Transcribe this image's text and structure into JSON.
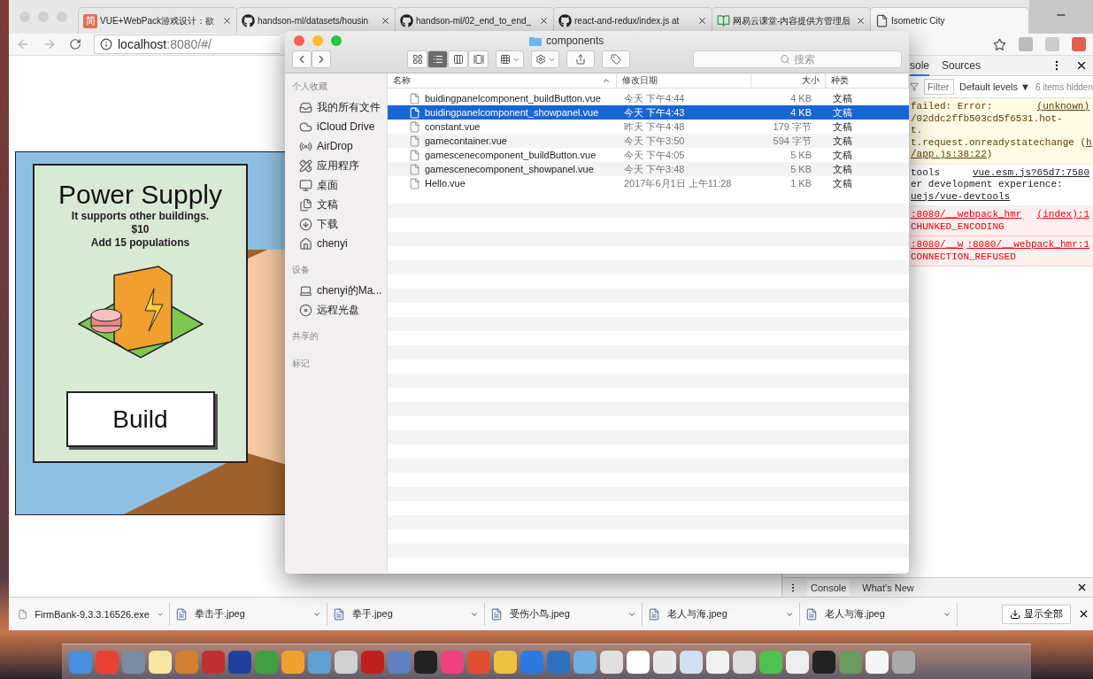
{
  "browser": {
    "tabs": [
      {
        "title": "VUE+WebPack游戏设计：欲",
        "kind": "badge",
        "badge": "简",
        "selected": false
      },
      {
        "title": "handson-ml/datasets/housin",
        "kind": "github",
        "selected": false
      },
      {
        "title": "handson-ml/02_end_to_end_",
        "kind": "github",
        "selected": false
      },
      {
        "title": "react-and-redux/index.js at",
        "kind": "github",
        "selected": false
      },
      {
        "title": "网易云课堂-内容提供方管理后",
        "kind": "book",
        "selected": false
      },
      {
        "title": "Isometric City",
        "kind": "page",
        "selected": true
      }
    ],
    "address": {
      "host": "localhost",
      "rest": ":8080/#/"
    }
  },
  "game": {
    "card": {
      "title": "Power Supply",
      "lines": [
        "It supports other buildings.",
        "$10",
        "Add 15 populations"
      ],
      "button": "Build"
    }
  },
  "finder": {
    "title": "components",
    "search_placeholder": "搜索",
    "sidebar": [
      {
        "heading": "个人收藏",
        "items": [
          {
            "label": "我的所有文件",
            "kind": "files"
          },
          {
            "label": "iCloud Drive",
            "kind": "cloud"
          },
          {
            "label": "AirDrop",
            "kind": "airdrop"
          },
          {
            "label": "应用程序",
            "kind": "apps"
          },
          {
            "label": "桌面",
            "kind": "desktop"
          },
          {
            "label": "文稿",
            "kind": "docs"
          },
          {
            "label": "下载",
            "kind": "download"
          },
          {
            "label": "chenyi",
            "kind": "home"
          }
        ]
      },
      {
        "heading": "设备",
        "items": [
          {
            "label": "chenyi的Ma...",
            "kind": "laptop"
          },
          {
            "label": "远程光盘",
            "kind": "disc"
          }
        ]
      },
      {
        "heading": "共享的"
      },
      {
        "heading": "标记"
      }
    ],
    "columns": [
      "名称",
      "修改日期",
      "大小",
      "种类"
    ],
    "rows": [
      {
        "name": "buidingpanelcomponent_buildButton.vue",
        "date": "今天 下午4:44",
        "size": "4 KB",
        "kind": "文稿",
        "selected": false
      },
      {
        "name": "buidingpanelcomponent_showpanel.vue",
        "date": "今天 下午4:43",
        "size": "4 KB",
        "kind": "文稿",
        "selected": true
      },
      {
        "name": "constant.vue",
        "date": "昨天 下午4:48",
        "size": "179 字节",
        "kind": "文稿",
        "selected": false
      },
      {
        "name": "gamecontainer.vue",
        "date": "今天 下午3:50",
        "size": "594 字节",
        "kind": "文稿",
        "selected": false
      },
      {
        "name": "gamescenecomponent_buildButton.vue",
        "date": "今天 下午4:05",
        "size": "5 KB",
        "kind": "文稿",
        "selected": false
      },
      {
        "name": "gamescenecomponent_showpanel.vue",
        "date": "今天 下午3:48",
        "size": "5 KB",
        "kind": "文稿",
        "selected": false
      },
      {
        "name": "Hello.vue",
        "date": "2017年6月1日 上午11:28",
        "size": "1 KB",
        "kind": "文稿",
        "selected": false
      }
    ]
  },
  "devtools": {
    "tabs": [
      {
        "label": "sole",
        "selected": true
      },
      {
        "label": "Sources",
        "selected": false
      }
    ],
    "filter_placeholder": "Filter",
    "levels": "Default levels ▼",
    "hidden": "6 items hidden",
    "messages": [
      {
        "kind": "warning",
        "lines": [
          [
            {
              "kind": "text",
              "text": "failed: Error:"
            },
            {
              "kind": "source",
              "text": "(unknown)"
            }
          ],
          [
            {
              "kind": "text",
              "text": "/02ddc2ffb503cd5f6531.hot-"
            }
          ],
          [
            {
              "kind": "text",
              "text": "t."
            }
          ],
          [
            {
              "kind": "text",
              "text": "t.request.onreadystatechange ("
            },
            {
              "kind": "link",
              "text": "h"
            }
          ],
          [
            {
              "kind": "link",
              "text": "/app.js:38:22"
            },
            {
              "kind": "text",
              "text": ")"
            }
          ]
        ]
      },
      {
        "kind": "info",
        "lines": [
          [
            {
              "kind": "text",
              "text": "tools"
            },
            {
              "kind": "source",
              "text": "vue.esm.js?65d7:7580"
            }
          ],
          [
            {
              "kind": "text",
              "text": "er development experience:"
            }
          ],
          [
            {
              "kind": "link",
              "text": "uejs/vue-devtools"
            }
          ]
        ]
      },
      {
        "kind": "error",
        "lines": [
          [
            {
              "kind": "link",
              "text": ":8080/__webpack_hmr"
            },
            {
              "kind": "source",
              "text": "(index):1"
            }
          ],
          [
            {
              "kind": "text",
              "text": "CHUNKED_ENCODING"
            }
          ]
        ]
      },
      {
        "kind": "error",
        "lines": [
          [
            {
              "kind": "link",
              "text": ":8080/__w"
            },
            {
              "kind": "source",
              "text": ":8080/__webpack_hmr:1"
            }
          ],
          [
            {
              "kind": "text",
              "text": "CONNECTION_REFUSED"
            }
          ]
        ]
      }
    ],
    "drawer_tabs": [
      {
        "label": "Console",
        "selected": true
      },
      {
        "label": "What's New",
        "selected": false
      }
    ]
  },
  "downloads": {
    "items": [
      "FirmBank-9.3.3.16526.exe",
      "拳击手.jpeg",
      "拳手.jpeg",
      "受伤小鸟.jpeg",
      "老人与海.jpeg",
      "老人与海.jpeg"
    ],
    "show_all": "显示全部"
  }
}
